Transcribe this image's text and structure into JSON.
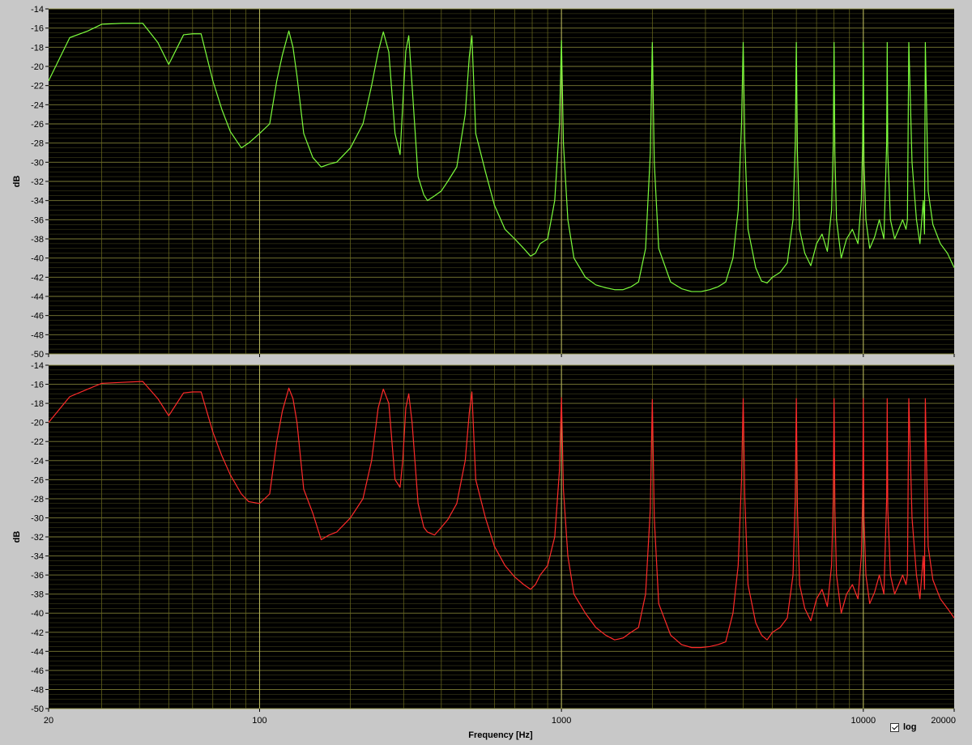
{
  "colors": {
    "plot_background": "#000000",
    "frame_background": "#c8c8c8",
    "grid_minor": "#6b6b1e",
    "grid_major": "#b5b55a",
    "grid_horizontal": "#8a8a3a",
    "series_top": "#7cfc3c",
    "series_bottom": "#ff2a2a"
  },
  "controls": {
    "log_label": "log",
    "log_checked": true
  },
  "chart_data": [
    {
      "type": "line",
      "title": "",
      "xlabel": "",
      "ylabel": "dB",
      "x_scale": "log",
      "xlim": [
        20,
        20000
      ],
      "ylim": [
        -50,
        -14
      ],
      "x_ticks": [
        20,
        100,
        1000,
        10000,
        20000
      ],
      "y_ticks": [
        -14,
        -16,
        -18,
        -20,
        -22,
        -24,
        -26,
        -28,
        -30,
        -32,
        -34,
        -36,
        -38,
        -40,
        -42,
        -44,
        -46,
        -48,
        -50
      ],
      "grid": true,
      "series": [
        {
          "color": "#7cfc3c",
          "x": [
            20,
            23.5,
            27,
            30,
            35,
            41,
            46,
            50,
            56,
            60,
            64,
            70,
            75,
            80,
            87,
            92,
            100,
            108,
            114,
            119,
            125,
            129,
            133,
            140,
            150,
            160,
            170,
            180,
            200,
            220,
            235,
            247,
            257,
            268,
            281,
            292,
            298,
            305,
            312,
            320,
            335,
            350,
            360,
            380,
            400,
            420,
            450,
            480,
            495,
            505,
            520,
            560,
            600,
            650,
            700,
            750,
            790,
            820,
            850,
            900,
            950,
            985,
            1000,
            1015,
            1050,
            1100,
            1200,
            1300,
            1400,
            1500,
            1600,
            1700,
            1800,
            1900,
            1970,
            2000,
            2030,
            2100,
            2300,
            2500,
            2700,
            2900,
            3100,
            3300,
            3500,
            3700,
            3850,
            3950,
            4000,
            4050,
            4150,
            4400,
            4600,
            4800,
            5000,
            5300,
            5600,
            5850,
            5950,
            6000,
            6050,
            6150,
            6400,
            6700,
            7000,
            7300,
            7600,
            7850,
            7950,
            8000,
            8050,
            8150,
            8450,
            8800,
            9200,
            9600,
            9850,
            9950,
            10000,
            10050,
            10200,
            10500,
            10900,
            11300,
            11700,
            11950,
            12000,
            12050,
            12300,
            12700,
            13100,
            13500,
            13850,
            14000,
            14150,
            14500,
            15000,
            15400,
            15800,
            15950,
            16000,
            16050,
            16400,
            17000,
            18000,
            19000,
            20000
          ],
          "y": [
            -21.5,
            -17,
            -16.3,
            -15.6,
            -15.5,
            -15.5,
            -17.5,
            -19.8,
            -16.7,
            -16.6,
            -16.6,
            -21.5,
            -24.5,
            -26.8,
            -28.5,
            -28,
            -27,
            -26,
            -21.5,
            -18.8,
            -16.3,
            -18,
            -21,
            -27,
            -29.5,
            -30.5,
            -30.2,
            -30,
            -28.5,
            -26,
            -22,
            -18.5,
            -16.4,
            -18.5,
            -27,
            -29.2,
            -24,
            -18.4,
            -16.8,
            -22,
            -31.5,
            -33.4,
            -34,
            -33.5,
            -33,
            -32,
            -30.5,
            -25,
            -19,
            -16.8,
            -27,
            -31,
            -34.5,
            -37,
            -38,
            -39,
            -39.8,
            -39.5,
            -38.5,
            -38,
            -34,
            -26,
            -17.3,
            -28,
            -36,
            -40,
            -42,
            -42.8,
            -43.1,
            -43.3,
            -43.3,
            -43,
            -42.5,
            -39,
            -29,
            -17.5,
            -30,
            -39,
            -42.5,
            -43.2,
            -43.5,
            -43.5,
            -43.3,
            -43,
            -42.5,
            -40,
            -35,
            -26,
            -17.5,
            -28,
            -37,
            -41,
            -42.4,
            -42.6,
            -42,
            -41.5,
            -40.5,
            -36,
            -28,
            -17.5,
            -29,
            -37,
            -39.5,
            -40.8,
            -38.5,
            -37.5,
            -39.3,
            -35,
            -28,
            -17.5,
            -29,
            -36,
            -40,
            -38,
            -37,
            -38.5,
            -34,
            -28,
            -17.5,
            -30,
            -36,
            -39,
            -37.8,
            -36,
            -38,
            -28,
            -17.5,
            -29,
            -36,
            -38,
            -37,
            -36,
            -37,
            -36,
            -17.5,
            -30,
            -36,
            -38.5,
            -34,
            -37.5,
            -27,
            -17.5,
            -33,
            -36.5,
            -38.5,
            -39.5,
            -41
          ]
        },
        {
          "color": "#ff2a2a",
          "x": [
            20,
            23.5,
            27,
            30,
            35,
            41,
            46,
            50,
            56,
            60,
            64,
            70,
            75,
            80,
            87,
            92,
            100,
            108,
            114,
            119,
            125,
            129,
            133,
            140,
            150,
            160,
            170,
            180,
            200,
            220,
            235,
            247,
            257,
            268,
            281,
            292,
            298,
            305,
            312,
            320,
            335,
            350,
            360,
            380,
            400,
            420,
            450,
            480,
            495,
            505,
            520,
            560,
            600,
            650,
            700,
            750,
            790,
            820,
            850,
            900,
            950,
            985,
            1000,
            1015,
            1050,
            1100,
            1200,
            1300,
            1400,
            1500,
            1600,
            1700,
            1800,
            1900,
            1970,
            2000,
            2030,
            2100,
            2300,
            2500,
            2700,
            2900,
            3100,
            3300,
            3500,
            3700,
            3850,
            3950,
            4000,
            4050,
            4150,
            4400,
            4600,
            4800,
            5000,
            5300,
            5600,
            5850,
            5950,
            6000,
            6050,
            6150,
            6400,
            6700,
            7000,
            7300,
            7600,
            7850,
            7950,
            8000,
            8050,
            8150,
            8450,
            8800,
            9200,
            9600,
            9850,
            9950,
            10000,
            10050,
            10200,
            10500,
            10900,
            11300,
            11700,
            11950,
            12000,
            12050,
            12300,
            12700,
            13100,
            13500,
            13850,
            14000,
            14150,
            14500,
            15000,
            15400,
            15800,
            15950,
            16000,
            16050,
            16400,
            17000,
            18000,
            19000,
            20000
          ],
          "y": [
            -20,
            -17.3,
            -16.5,
            -15.9,
            -15.8,
            -15.7,
            -17.5,
            -19.3,
            -16.9,
            -16.8,
            -16.8,
            -21,
            -23.5,
            -25.5,
            -27.5,
            -28.3,
            -28.5,
            -27.5,
            -22,
            -18.8,
            -16.4,
            -17.5,
            -20,
            -27,
            -29.5,
            -32.3,
            -31.8,
            -31.5,
            -30,
            -28,
            -24,
            -18.5,
            -16.5,
            -18,
            -26,
            -26.8,
            -24,
            -18.5,
            -17,
            -20,
            -28.5,
            -31,
            -31.5,
            -31.8,
            -31,
            -30.2,
            -28.5,
            -24,
            -19,
            -16.8,
            -26,
            -30,
            -33,
            -35,
            -36.2,
            -37,
            -37.5,
            -37,
            -36,
            -35,
            -32,
            -25,
            -17.4,
            -27,
            -34,
            -38,
            -40,
            -41.5,
            -42.3,
            -42.8,
            -42.6,
            -42,
            -41.5,
            -38,
            -29,
            -17.6,
            -30,
            -39,
            -42.3,
            -43.3,
            -43.6,
            -43.6,
            -43.5,
            -43.3,
            -43,
            -40,
            -35,
            -26,
            -17.5,
            -28,
            -37,
            -41,
            -42.3,
            -42.8,
            -42,
            -41.5,
            -40.5,
            -36,
            -28,
            -17.5,
            -29,
            -37,
            -39.5,
            -40.8,
            -38.5,
            -37.5,
            -39.3,
            -35,
            -28,
            -17.5,
            -29,
            -36,
            -40,
            -38,
            -37,
            -38.5,
            -34,
            -28,
            -17.5,
            -30,
            -36,
            -39,
            -37.8,
            -36,
            -38,
            -28,
            -17.5,
            -29,
            -36,
            -38,
            -37,
            -36,
            -37,
            -36,
            -17.5,
            -30,
            -36,
            -38.5,
            -34,
            -37.5,
            -27,
            -17.5,
            -33,
            -36.5,
            -38.5,
            -39.5,
            -40.5
          ]
        }
      ]
    }
  ],
  "x_axis": {
    "label": "Frequency [Hz]"
  }
}
